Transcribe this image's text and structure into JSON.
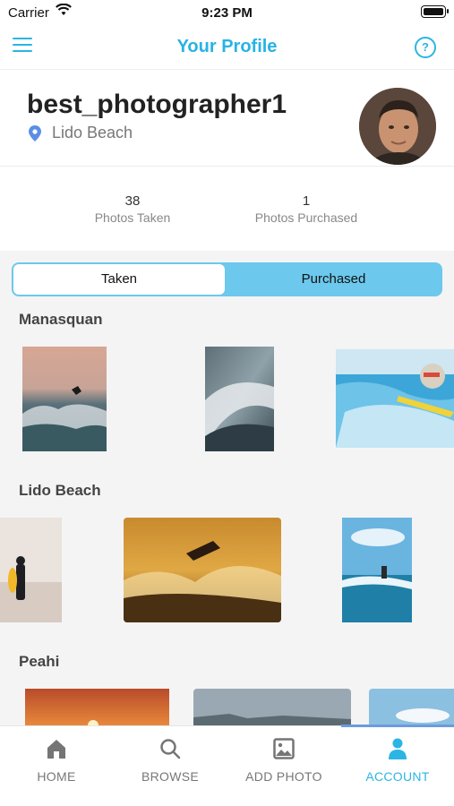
{
  "status_bar": {
    "carrier": "Carrier",
    "time": "9:23 PM"
  },
  "navbar": {
    "title": "Your Profile",
    "help_glyph": "?",
    "menu_icon": "hamburger-menu-icon",
    "help_icon": "help-circle-icon"
  },
  "profile": {
    "username": "best_photographer1",
    "location": "Lido Beach"
  },
  "stats": [
    {
      "value": "38",
      "label": "Photos Taken"
    },
    {
      "value": "1",
      "label": "Photos Purchased"
    }
  ],
  "segment": {
    "options": [
      "Taken",
      "Purchased"
    ],
    "selected": "Taken"
  },
  "sections": [
    {
      "title": "Manasquan"
    },
    {
      "title": "Lido Beach"
    },
    {
      "title": "Peahi"
    }
  ],
  "tabs": [
    {
      "label": "HOME",
      "icon": "home-icon"
    },
    {
      "label": "BROWSE",
      "icon": "search-icon"
    },
    {
      "label": "ADD PHOTO",
      "icon": "image-icon"
    },
    {
      "label": "ACCOUNT",
      "icon": "user-icon",
      "active": true
    }
  ],
  "colors": {
    "accent": "#2bb5e4",
    "segment_bg": "#6cc8ec",
    "tab_indicator": "#6c9bde"
  }
}
